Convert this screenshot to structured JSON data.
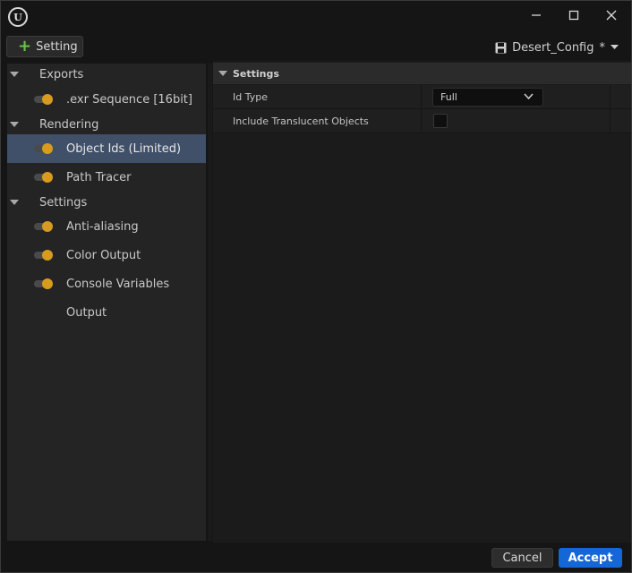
{
  "titlebar": {
    "logo_letter": "U",
    "minimize_glyph": "—",
    "maximize_glyph": "☐",
    "close_glyph": "✕"
  },
  "toolbar": {
    "add_setting_label": "Setting",
    "config_name": "Desert_Config",
    "config_dirty_marker": "*"
  },
  "tree": {
    "categories": [
      {
        "label": "Exports"
      },
      {
        "label": "Rendering"
      },
      {
        "label": "Settings"
      }
    ],
    "items": [
      {
        "label": ".exr Sequence [16bit]",
        "enabled": true
      },
      {
        "label": "Object Ids (Limited)",
        "enabled": true,
        "selected": true
      },
      {
        "label": "Path Tracer",
        "enabled": true
      },
      {
        "label": "Anti-aliasing",
        "enabled": true
      },
      {
        "label": "Color Output",
        "enabled": true
      },
      {
        "label": "Console Variables",
        "enabled": true
      },
      {
        "label": "Output",
        "enabled": false
      }
    ]
  },
  "details": {
    "section_title": "Settings",
    "properties": [
      {
        "name": "Id Type",
        "value": "Full"
      },
      {
        "name": "Include Translucent Objects",
        "checked": false
      }
    ]
  },
  "footer": {
    "cancel_label": "Cancel",
    "accept_label": "Accept"
  },
  "colors": {
    "accent": "#1467d6",
    "selection": "#405068",
    "toggle_on": "#d99b1d",
    "add_icon": "#6cc24a"
  }
}
